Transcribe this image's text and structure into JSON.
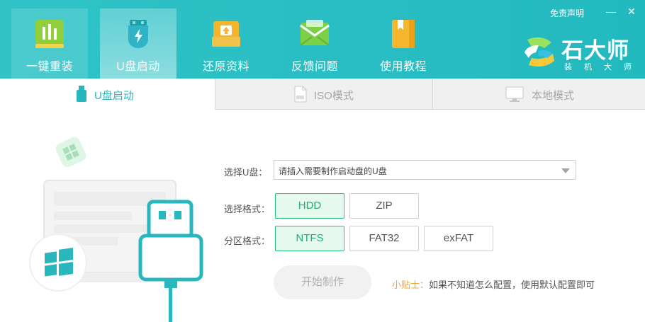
{
  "header": {
    "nav": [
      {
        "label": "一键重装",
        "icon": "bar-chart-icon"
      },
      {
        "label": "U盘启动",
        "icon": "usb-flash-icon"
      },
      {
        "label": "还原资料",
        "icon": "restore-box-icon"
      },
      {
        "label": "反馈问题",
        "icon": "feedback-mail-icon"
      },
      {
        "label": "使用教程",
        "icon": "tutorial-book-icon"
      }
    ],
    "disclaimer": "免责声明",
    "minimize": "—",
    "close": "✕",
    "logo": {
      "title": "石大师",
      "subtitle": "装机大师"
    }
  },
  "tabs": [
    {
      "label": "U盘启动",
      "icon": "usb-icon",
      "active": true
    },
    {
      "label": "ISO模式",
      "icon": "iso-file-icon",
      "active": false
    },
    {
      "label": "本地模式",
      "icon": "monitor-icon",
      "active": false
    }
  ],
  "form": {
    "select_usb_label": "选择U盘：",
    "select_usb_placeholder": "请插入需要制作启动盘的U盘",
    "format_label": "选择格式：",
    "format_options": [
      {
        "label": "HDD",
        "selected": true
      },
      {
        "label": "ZIP",
        "selected": false
      }
    ],
    "partition_label": "分区格式：",
    "partition_options": [
      {
        "label": "NTFS",
        "selected": true
      },
      {
        "label": "FAT32",
        "selected": false
      },
      {
        "label": "exFAT",
        "selected": false
      }
    ],
    "start_button": "开始制作",
    "tip_key": "小贴士：",
    "tip_text": "如果不知道怎么配置，使用默认配置即可"
  },
  "colors": {
    "header_bg": "#2fc3c7",
    "accent_green": "#22bf7f",
    "tab_active": "#26b6bb",
    "tip_orange": "#f0a43a"
  }
}
